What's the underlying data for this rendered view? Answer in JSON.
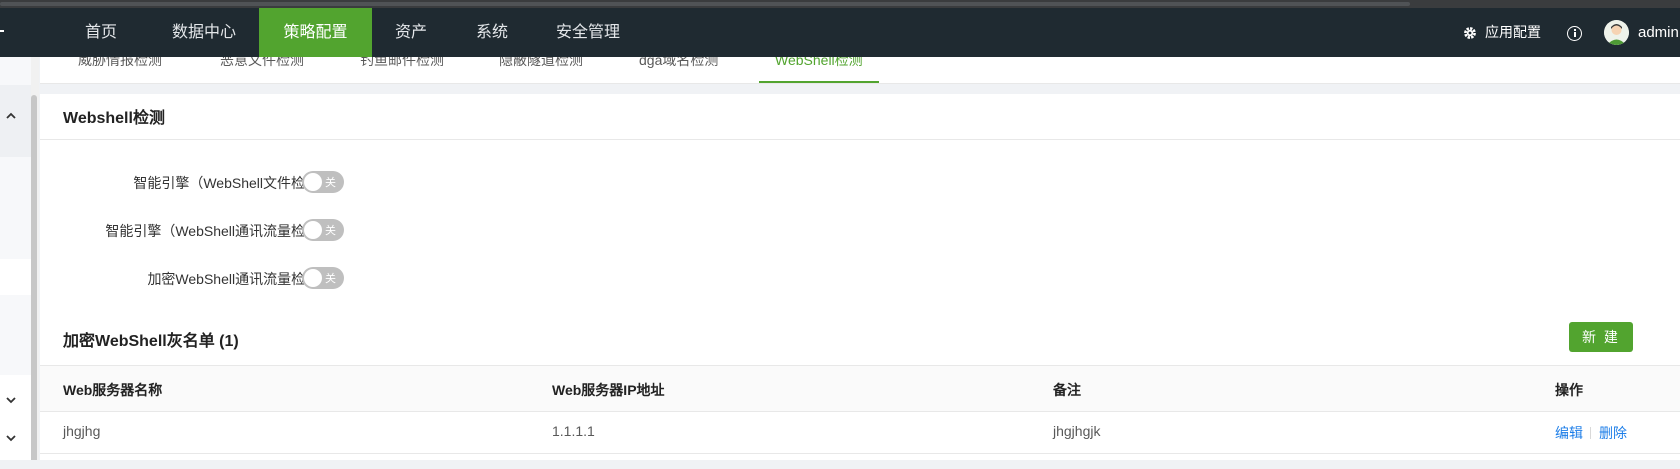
{
  "nav": {
    "items": [
      {
        "label": "首页"
      },
      {
        "label": "数据中心"
      },
      {
        "label": "策略配置"
      },
      {
        "label": "资产"
      },
      {
        "label": "系统"
      },
      {
        "label": "安全管理"
      }
    ],
    "active_index": 2,
    "app_config_label": "应用配置",
    "user_name": "admin"
  },
  "subtabs": [
    {
      "label": "威胁情报检测"
    },
    {
      "label": "恶意文件检测"
    },
    {
      "label": "钓鱼邮件检测"
    },
    {
      "label": "隐蔽隧道检测"
    },
    {
      "label": "dga域名检测"
    },
    {
      "label": "WebShell检测"
    }
  ],
  "section": {
    "title": "Webshell检测",
    "settings": [
      {
        "label": "智能引擎（WebShell文件检测）：",
        "toggle_text": "关",
        "enabled": false
      },
      {
        "label": "智能引擎（WebShell通讯流量检测）：",
        "toggle_text": "关",
        "enabled": false
      },
      {
        "label": "加密WebShell通讯流量检测",
        "suffix": ":",
        "toggle_text": "关",
        "enabled": false,
        "help_icon": "question-circle-icon"
      }
    ]
  },
  "graylist": {
    "title": "加密WebShell灰名单 (1)",
    "new_button": "新 建",
    "columns": [
      "Web服务器名称",
      "Web服务器IP地址",
      "备注",
      "操作"
    ],
    "rows": [
      {
        "name": "jhgjhg",
        "ip": "1.1.1.1",
        "note": "jhgjhgjk",
        "edit": "编辑",
        "delete": "删除"
      }
    ]
  },
  "colors": {
    "accent": "#52a42f",
    "nav_bg": "#1f2a31",
    "link": "#1d7ee8"
  }
}
